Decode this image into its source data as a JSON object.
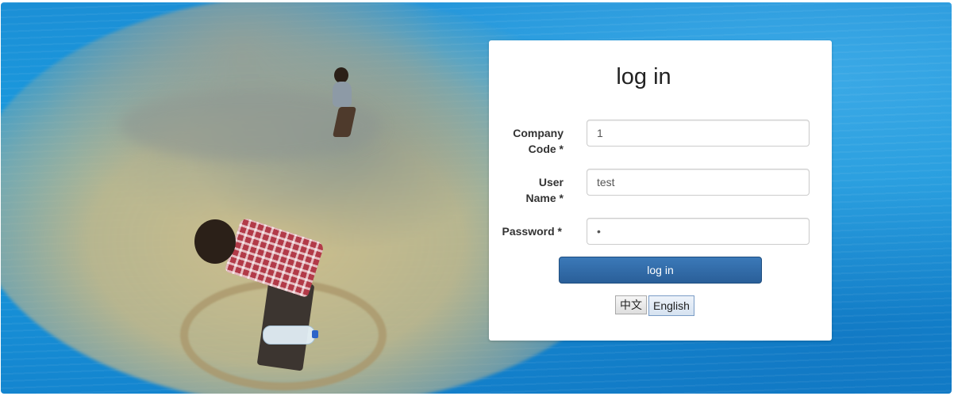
{
  "login": {
    "title": "log in",
    "fields": {
      "company_code": {
        "label_line1": "Company",
        "label_line2": "Code *",
        "value": "1"
      },
      "user_name": {
        "label_line1": "User",
        "label_line2": "Name *",
        "value": "test"
      },
      "password": {
        "label": "Password *",
        "value": "•"
      }
    },
    "submit_label": "log in",
    "languages": [
      {
        "label": "中文",
        "selected": false
      },
      {
        "label": "English",
        "selected": true
      }
    ]
  },
  "colors": {
    "primary_button": "#2a5f99",
    "background_water": "#1a9de0",
    "card_background": "#ffffff"
  }
}
